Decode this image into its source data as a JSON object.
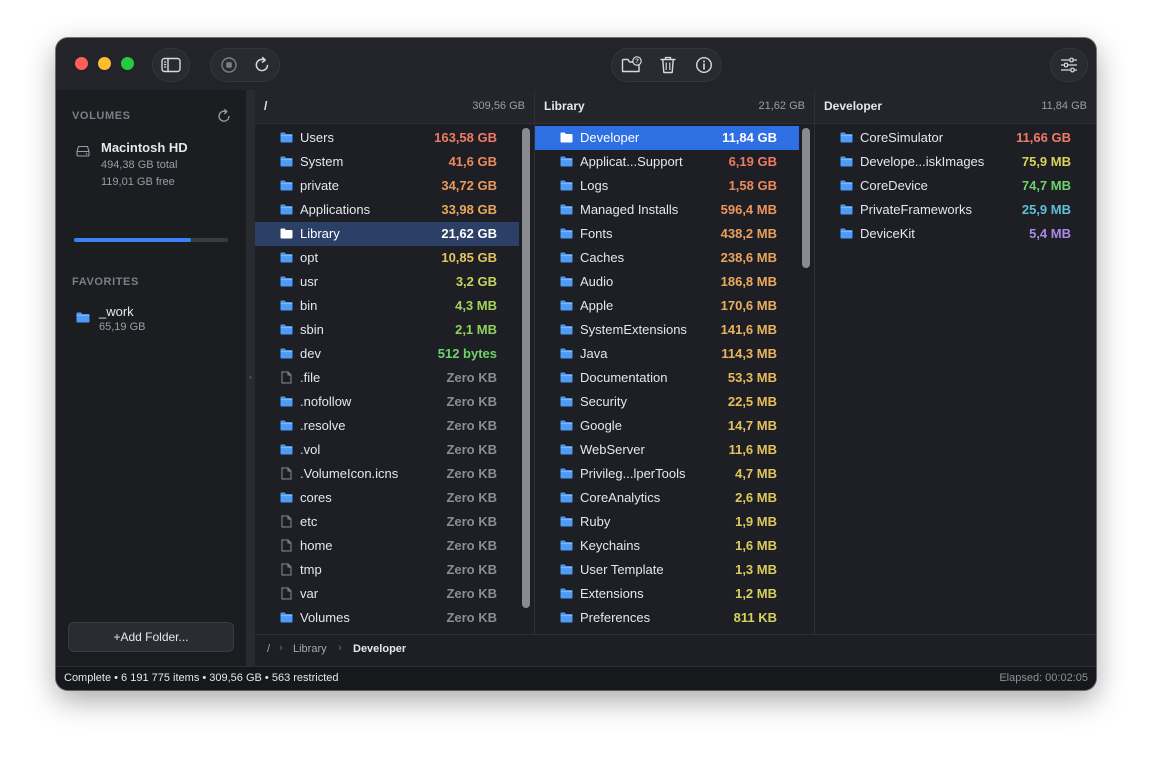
{
  "sidebar": {
    "volumes_header": "VOLUMES",
    "volume": {
      "name": "Macintosh HD",
      "total": "494,38 GB total",
      "free": "119,01 GB free",
      "usage_fraction": 0.76,
      "icon": "drive-icon"
    },
    "favorites_header": "FAVORITES",
    "favorite": {
      "name": "_work",
      "size": "65,19 GB",
      "icon": "folder-icon"
    },
    "add_folder_label": "+Add Folder..."
  },
  "columns": [
    {
      "title": "/",
      "total": "309,56 GB",
      "selected_index": 4,
      "active": false,
      "rows": [
        {
          "name": "Users",
          "size": "163,58 GB",
          "icon": "folder",
          "color": "#f07a64"
        },
        {
          "name": "System",
          "size": "41,6 GB",
          "icon": "folder",
          "color": "#ee8a5c"
        },
        {
          "name": "private",
          "size": "34,72 GB",
          "icon": "folder",
          "color": "#eb9a5c"
        },
        {
          "name": "Applications",
          "size": "33,98 GB",
          "icon": "folder",
          "color": "#eba75c"
        },
        {
          "name": "Library",
          "size": "21,62 GB",
          "icon": "folder",
          "color": "#ffffff"
        },
        {
          "name": "opt",
          "size": "10,85 GB",
          "icon": "folder",
          "color": "#e3c45e"
        },
        {
          "name": "usr",
          "size": "3,2 GB",
          "icon": "folder",
          "color": "#c9d35e"
        },
        {
          "name": "bin",
          "size": "4,3 MB",
          "icon": "folder",
          "color": "#a6d35e"
        },
        {
          "name": "sbin",
          "size": "2,1 MB",
          "icon": "folder",
          "color": "#8fd35e"
        },
        {
          "name": "dev",
          "size": "512 bytes",
          "icon": "folder",
          "color": "#6cd36a"
        },
        {
          "name": ".file",
          "size": "Zero KB",
          "icon": "file",
          "color": "#8a8d95"
        },
        {
          "name": ".nofollow",
          "size": "Zero KB",
          "icon": "folder",
          "color": "#8a8d95"
        },
        {
          "name": ".resolve",
          "size": "Zero KB",
          "icon": "folder",
          "color": "#8a8d95"
        },
        {
          "name": ".vol",
          "size": "Zero KB",
          "icon": "folder",
          "color": "#8a8d95"
        },
        {
          "name": ".VolumeIcon.icns",
          "size": "Zero KB",
          "icon": "file",
          "color": "#8a8d95"
        },
        {
          "name": "cores",
          "size": "Zero KB",
          "icon": "folder",
          "color": "#8a8d95"
        },
        {
          "name": "etc",
          "size": "Zero KB",
          "icon": "file",
          "color": "#8a8d95"
        },
        {
          "name": "home",
          "size": "Zero KB",
          "icon": "file",
          "color": "#8a8d95"
        },
        {
          "name": "tmp",
          "size": "Zero KB",
          "icon": "file",
          "color": "#8a8d95"
        },
        {
          "name": "var",
          "size": "Zero KB",
          "icon": "file",
          "color": "#8a8d95"
        },
        {
          "name": "Volumes",
          "size": "Zero KB",
          "icon": "folder",
          "color": "#8a8d95"
        }
      ]
    },
    {
      "title": "Library",
      "total": "21,62 GB",
      "selected_index": 0,
      "active": true,
      "rows": [
        {
          "name": "Developer",
          "size": "11,84 GB",
          "icon": "folder",
          "color": "#ffffff"
        },
        {
          "name": "Applicat...Support",
          "size": "6,19 GB",
          "icon": "folder",
          "color": "#f07a64"
        },
        {
          "name": "Logs",
          "size": "1,58 GB",
          "icon": "folder",
          "color": "#ee8a5c"
        },
        {
          "name": "Managed Installs",
          "size": "596,4 MB",
          "icon": "folder",
          "color": "#eb975c"
        },
        {
          "name": "Fonts",
          "size": "438,2 MB",
          "icon": "folder",
          "color": "#eb9f5c"
        },
        {
          "name": "Caches",
          "size": "238,6 MB",
          "icon": "folder",
          "color": "#eba55c"
        },
        {
          "name": "Audio",
          "size": "186,8 MB",
          "icon": "folder",
          "color": "#ebaa5c"
        },
        {
          "name": "Apple",
          "size": "170,6 MB",
          "icon": "folder",
          "color": "#ebae5c"
        },
        {
          "name": "SystemExtensions",
          "size": "141,6 MB",
          "icon": "folder",
          "color": "#ebb25c"
        },
        {
          "name": "Java",
          "size": "114,3 MB",
          "icon": "folder",
          "color": "#ebb55c"
        },
        {
          "name": "Documentation",
          "size": "53,3 MB",
          "icon": "folder",
          "color": "#e8bb5c"
        },
        {
          "name": "Security",
          "size": "22,5 MB",
          "icon": "folder",
          "color": "#e6be5c"
        },
        {
          "name": "Google",
          "size": "14,7 MB",
          "icon": "folder",
          "color": "#e4c15c"
        },
        {
          "name": "WebServer",
          "size": "11,6 MB",
          "icon": "folder",
          "color": "#e3c35c"
        },
        {
          "name": "Privileg...lperTools",
          "size": "4,7 MB",
          "icon": "folder",
          "color": "#e1c65c"
        },
        {
          "name": "CoreAnalytics",
          "size": "2,6 MB",
          "icon": "folder",
          "color": "#dfc85c"
        },
        {
          "name": "Ruby",
          "size": "1,9 MB",
          "icon": "folder",
          "color": "#ddca5c"
        },
        {
          "name": "Keychains",
          "size": "1,6 MB",
          "icon": "folder",
          "color": "#dbcc5c"
        },
        {
          "name": "User Template",
          "size": "1,3 MB",
          "icon": "folder",
          "color": "#d9ce5c"
        },
        {
          "name": "Extensions",
          "size": "1,2 MB",
          "icon": "folder",
          "color": "#d7d05c"
        },
        {
          "name": "Preferences",
          "size": "811 KB",
          "icon": "folder",
          "color": "#d5d25c"
        }
      ]
    },
    {
      "title": "Developer",
      "total": "11,84 GB",
      "selected_index": -1,
      "active": false,
      "rows": [
        {
          "name": "CoreSimulator",
          "size": "11,66 GB",
          "icon": "folder",
          "color": "#f07a64"
        },
        {
          "name": "Develope...iskImages",
          "size": "75,9 MB",
          "icon": "folder",
          "color": "#d9d45c"
        },
        {
          "name": "CoreDevice",
          "size": "74,7 MB",
          "icon": "folder",
          "color": "#6cd36a"
        },
        {
          "name": "PrivateFrameworks",
          "size": "25,9 MB",
          "icon": "folder",
          "color": "#5fc0d8"
        },
        {
          "name": "DeviceKit",
          "size": "5,4 MB",
          "icon": "folder",
          "color": "#a98ae6"
        }
      ]
    }
  ],
  "breadcrumb": [
    "/",
    "Library",
    "Developer"
  ],
  "status": {
    "left": "Complete • 6 191 775 items • 309,56 GB • 563 restricted",
    "right": "Elapsed: 00:02:05"
  },
  "colors": {
    "accent": "#2f6fe4",
    "folder": "#4c9bf6"
  }
}
